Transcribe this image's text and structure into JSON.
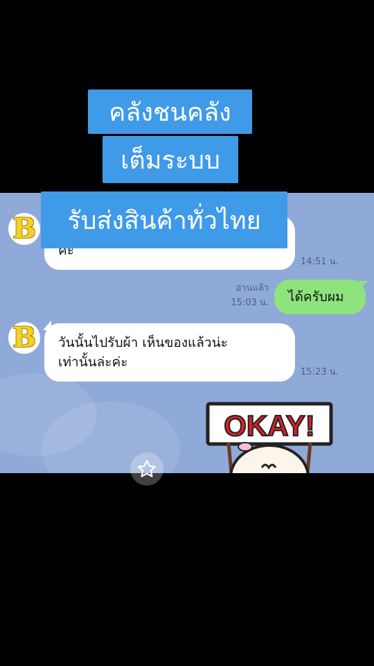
{
  "captions": [
    "คลังชนคลัง",
    "เต็มระบบ",
    "รับส่งสินค้าทั่วไทย"
  ],
  "avatar_letter": "B",
  "messages": [
    {
      "type": "incoming",
      "text": "ค่ะ",
      "time": "14:51 น."
    },
    {
      "type": "outgoing",
      "text": "ได้ครับผม",
      "read": "อ่านแล้ว",
      "time": "15:03 น."
    },
    {
      "type": "incoming",
      "lines": [
        "วันนั้นไปรับผ้า  เห็นของแล้วน่ะ",
        "เท่านั้นล่ะค่ะ"
      ],
      "time": "15:23 น."
    }
  ],
  "sticker": {
    "text": "OKAY!"
  },
  "icons": {
    "avatar": "brand-b-icon",
    "star": "star-icon"
  },
  "colors": {
    "chat_bg": "#8fa9d8",
    "caption_bg": "#3f9ae8",
    "outgoing_bubble": "#8ee37c",
    "sticker_red": "#d9202a"
  }
}
